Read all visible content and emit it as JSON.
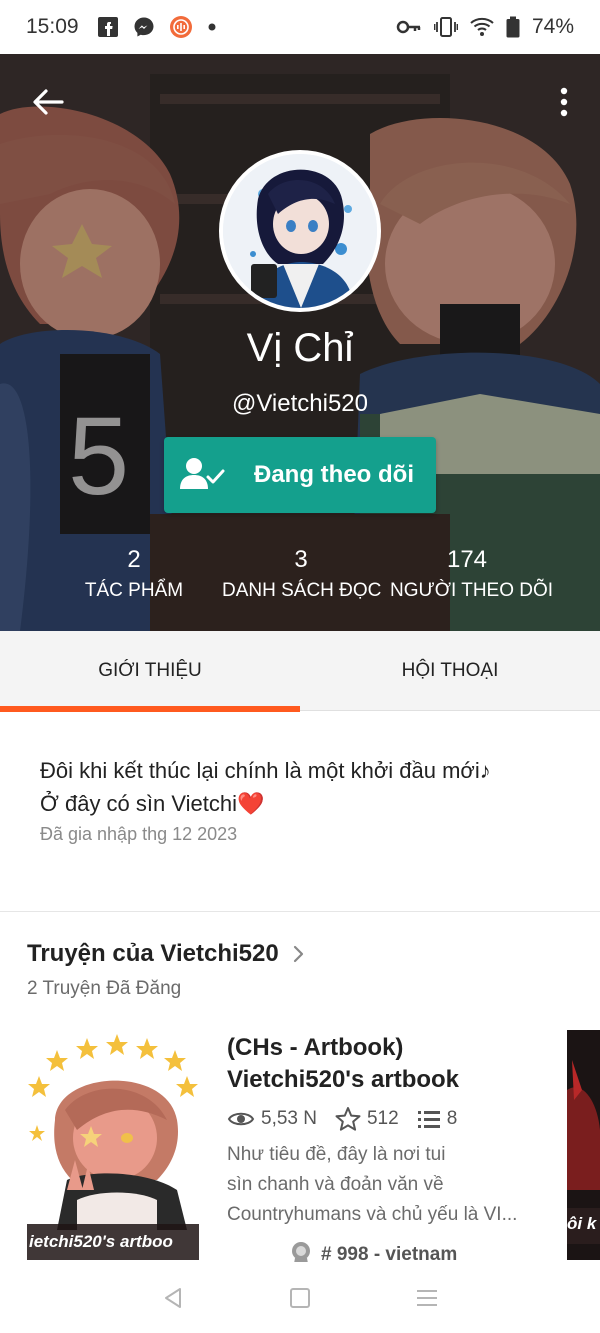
{
  "status_bar": {
    "time": "15:09",
    "battery": "74%",
    "icons": [
      "facebook-icon",
      "messenger-icon",
      "podcast-icon",
      "dot-icon",
      "key-icon",
      "vibrate-icon",
      "wifi-icon",
      "battery-icon"
    ]
  },
  "profile": {
    "display_name": "Vị Chỉ",
    "handle": "@Vietchi520",
    "follow_label": "Đang theo dõi",
    "stats": [
      {
        "num": "2",
        "label": "TÁC PHẨM"
      },
      {
        "num": "3",
        "label": "DANH SÁCH ĐỌC"
      },
      {
        "num": "174",
        "label": "NGƯỜI THEO DÕI"
      }
    ]
  },
  "tabs": [
    {
      "label": "GIỚI THIỆU",
      "active": true
    },
    {
      "label": "HỘI THOẠI",
      "active": false
    }
  ],
  "about": {
    "bio_line1": "Đôi khi kết thúc lại chính là một khởi đầu mới♪",
    "bio_line2": "Ở đây có sìn Vietchi❤️",
    "joined": "Đã gia nhập thg 12 2023"
  },
  "stories": {
    "title": "Truyện của Vietchi520",
    "count": "2 Truyện Đã Đăng",
    "items": [
      {
        "title_line1": "(CHs - Artbook)",
        "title_line2": "Vietchi520's artbook",
        "reads": "5,53 N",
        "votes": "512",
        "parts": "8",
        "desc_line1": "Như tiêu đề, đây là nơi tui",
        "desc_line2": "sìn chanh và đoản văn về",
        "desc_line3": "Countryhumans và chủ yếu là VI...",
        "rank": "# 998 - vietnam",
        "cover_caption": "ietchi520's artboo"
      }
    ],
    "next_cover_caption": "ôi k"
  },
  "colors": {
    "accent_teal": "#14a08d",
    "accent_orange": "#ff5a1f"
  }
}
